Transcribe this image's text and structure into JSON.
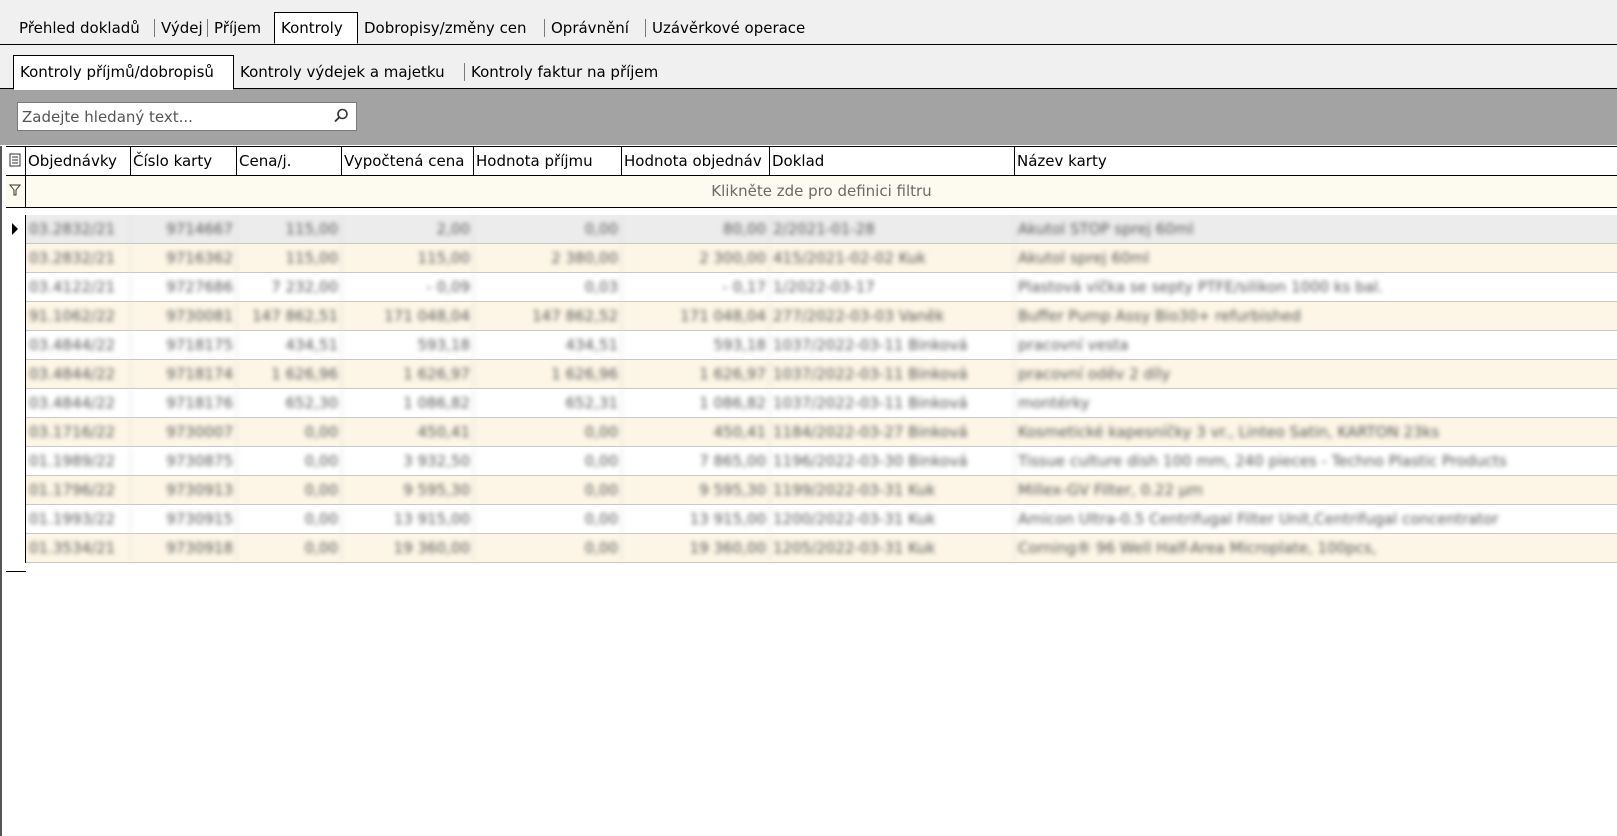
{
  "main_tabs": [
    {
      "label": "Přehled dokladů",
      "active": false
    },
    {
      "label": "Výdej",
      "active": false
    },
    {
      "label": "Příjem",
      "active": false
    },
    {
      "label": "Kontroly",
      "active": true
    },
    {
      "label": "Dobropisy/změny cen",
      "active": false
    },
    {
      "label": "Oprávnění",
      "active": false
    },
    {
      "label": "Uzávěrkové operace",
      "active": false
    }
  ],
  "sub_tabs": [
    {
      "label": "Kontroly příjmů/dobropisů",
      "active": true
    },
    {
      "label": "Kontroly výdejek a majetku",
      "active": false
    },
    {
      "label": "Kontroly faktur na příjem",
      "active": false
    }
  ],
  "search": {
    "placeholder": "Zadejte hledaný text...",
    "value": ""
  },
  "grid": {
    "columns": [
      "Objednávky",
      "Číslo karty",
      "Cena/j.",
      "Vypočtená cena",
      "Hodnota příjmu",
      "Hodnota objednáv",
      "Doklad",
      "Název karty"
    ],
    "filter_hint": "Klikněte zde pro definici filtru",
    "rows": [
      [
        "03.2832/21",
        "9714667",
        "115,00",
        "2,00",
        "0,00",
        "80,00",
        "2/2021-01-28",
        "Akutol STOP sprej 60ml"
      ],
      [
        "03.2832/21",
        "9716362",
        "115,00",
        "115,00",
        "2 380,00",
        "2 300,00",
        "415/2021-02-02 Kuk",
        "Akutol sprej 60ml"
      ],
      [
        "03.4122/21",
        "9727686",
        "7 232,00",
        "- 0,09",
        "0,03",
        "- 0,17",
        "1/2022-03-17",
        "Plastová víčka se septy PTFE/silikon 1000 ks bal."
      ],
      [
        "91.1062/22",
        "9730081",
        "147 862,51",
        "171 048,04",
        "147 862,52",
        "171 048,04",
        "277/2022-03-03 Vaněk",
        "Buffer Pump Assy Bio30+ refurbished"
      ],
      [
        "03.4844/22",
        "9718175",
        "434,51",
        "593,18",
        "434,51",
        "593,18",
        "1037/2022-03-11 Binková",
        "pracovní vesta"
      ],
      [
        "03.4844/22",
        "9718174",
        "1 626,96",
        "1 626,97",
        "1 626,96",
        "1 626,97",
        "1037/2022-03-11 Binková",
        "pracovní oděv 2 díly"
      ],
      [
        "03.4844/22",
        "9718176",
        "652,30",
        "1 086,82",
        "652,31",
        "1 086,82",
        "1037/2022-03-11 Binková",
        "montérky"
      ],
      [
        "03.1716/22",
        "9730007",
        "0,00",
        "450,41",
        "0,00",
        "450,41",
        "1184/2022-03-27 Binková",
        "Kosmetické kapesníčky 3 vr., Linteo Satin, KARTON 23ks"
      ],
      [
        "01.1989/22",
        "9730875",
        "0,00",
        "3 932,50",
        "0,00",
        "7 865,00",
        "1196/2022-03-30 Binková",
        "Tissue culture dish 100 mm, 240 pieces - Techno Plastic Products"
      ],
      [
        "01.1796/22",
        "9730913",
        "0,00",
        "9 595,30",
        "0,00",
        "9 595,30",
        "1199/2022-03-31 Kuk",
        "Millex-GV Filter, 0.22 µm"
      ],
      [
        "01.1993/22",
        "9730915",
        "0,00",
        "13 915,00",
        "0,00",
        "13 915,00",
        "1200/2022-03-31 Kuk",
        "Amicon Ultra-0.5 Centrifugal Filter Unit,Centrifugal concentrator"
      ],
      [
        "01.3534/21",
        "9730918",
        "0,00",
        "19 360,00",
        "0,00",
        "19 360,00",
        "1205/2022-03-31 Kuk",
        "Corning® 96 Well Half-Area Microplate, 100pcs,"
      ]
    ]
  }
}
